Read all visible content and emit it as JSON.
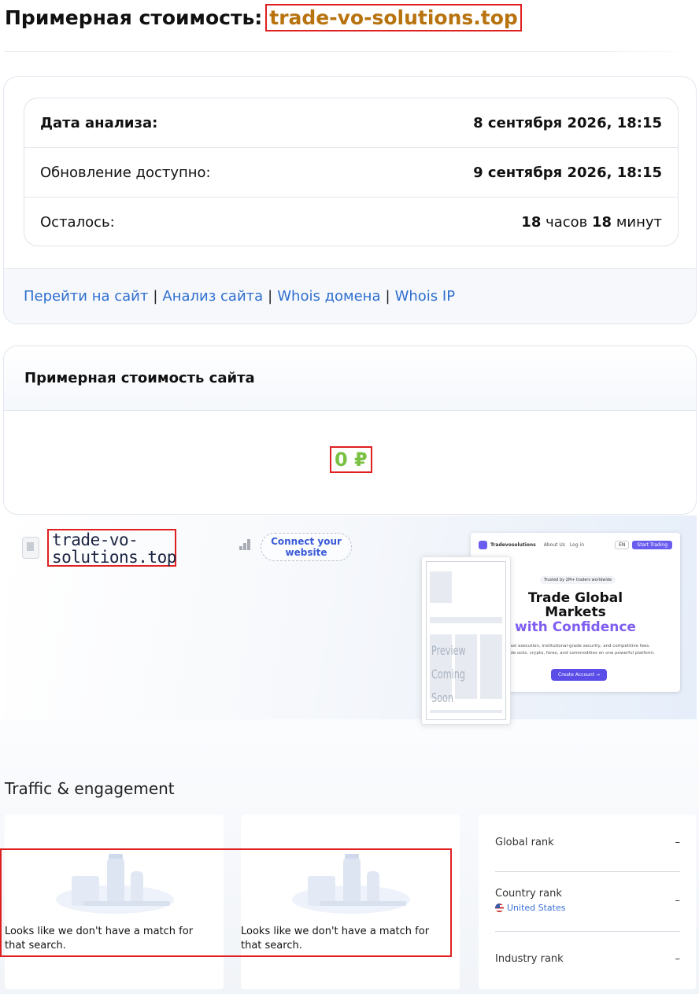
{
  "header": {
    "title_prefix": "Примерная стоимость:",
    "domain": "trade-vo-solutions.top"
  },
  "info": {
    "rows": [
      {
        "label": "Дата анализа:",
        "value": "8 сентября 2026, 18:15"
      },
      {
        "label": "Обновление доступно:",
        "value": "9 сентября 2026, 18:15"
      },
      {
        "label": "Осталось:",
        "hours": "18",
        "hours_unit": "часов",
        "minutes": "18",
        "minutes_unit": "минут"
      }
    ],
    "links": [
      "Перейти на сайт",
      "Анализ сайта",
      "Whois домена",
      "Whois IP"
    ],
    "separator": "|"
  },
  "valuation": {
    "title": "Примерная стоимость сайта",
    "amount": "0 ₽"
  },
  "preview": {
    "domain_line1": "trade-vo-",
    "domain_line2": "solutions.top",
    "connect_label": "Connect your website",
    "screenshot": {
      "brand": "Tradevosolutions",
      "nav_links": [
        "About Us",
        "Log in"
      ],
      "lang": "EN",
      "start_btn": "Start Trading",
      "badge": "Trusted by 2M+ traders worldwide",
      "headline1": "Trade Global",
      "headline2": "Markets",
      "headline3": "with Confidence",
      "subtext": "fast execution, institutional-grade security, and competitive fees. Trade ocks, crypto, forex, and commodities on one powerful platform.",
      "cta": "Create Account →"
    },
    "phone_placeholder_1": "Preview",
    "phone_placeholder_2": "Coming Soon"
  },
  "traffic": {
    "title": "Traffic & engagement",
    "empty_message": "Looks like we don't have a match for that search.",
    "ranks": [
      {
        "label": "Global rank",
        "value": "–"
      },
      {
        "label": "Country rank",
        "sub": "United States",
        "value": "–"
      },
      {
        "label": "Industry rank",
        "value": "–"
      }
    ]
  }
}
